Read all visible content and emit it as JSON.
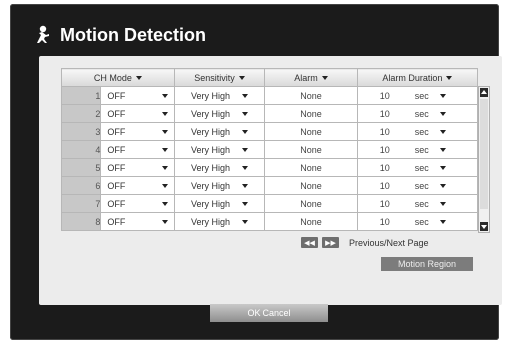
{
  "dialog": {
    "title": "Motion Detection",
    "title_icon": "person-motion-icon"
  },
  "table": {
    "headers": {
      "ch_mode": "CH Mode",
      "sensitivity": "Sensitivity",
      "alarm": "Alarm",
      "alarm_duration": "Alarm Duration"
    },
    "rows": [
      {
        "ch": "1",
        "mode": "OFF",
        "sensitivity": "Very High",
        "alarm": "None",
        "duration": "10",
        "unit": "sec"
      },
      {
        "ch": "2",
        "mode": "OFF",
        "sensitivity": "Very High",
        "alarm": "None",
        "duration": "10",
        "unit": "sec"
      },
      {
        "ch": "3",
        "mode": "OFF",
        "sensitivity": "Very High",
        "alarm": "None",
        "duration": "10",
        "unit": "sec"
      },
      {
        "ch": "4",
        "mode": "OFF",
        "sensitivity": "Very High",
        "alarm": "None",
        "duration": "10",
        "unit": "sec"
      },
      {
        "ch": "5",
        "mode": "OFF",
        "sensitivity": "Very High",
        "alarm": "None",
        "duration": "10",
        "unit": "sec"
      },
      {
        "ch": "6",
        "mode": "OFF",
        "sensitivity": "Very High",
        "alarm": "None",
        "duration": "10",
        "unit": "sec"
      },
      {
        "ch": "7",
        "mode": "OFF",
        "sensitivity": "Very High",
        "alarm": "None",
        "duration": "10",
        "unit": "sec"
      },
      {
        "ch": "8",
        "mode": "OFF",
        "sensitivity": "Very High",
        "alarm": "None",
        "duration": "10",
        "unit": "sec"
      }
    ]
  },
  "pager": {
    "prev_label": "◀◀",
    "next_label": "▶▶",
    "label": "Previous/Next Page"
  },
  "motion_region_label": "Motion Region",
  "footer": {
    "ok_label": "OK",
    "cancel_label": "Cancel"
  }
}
